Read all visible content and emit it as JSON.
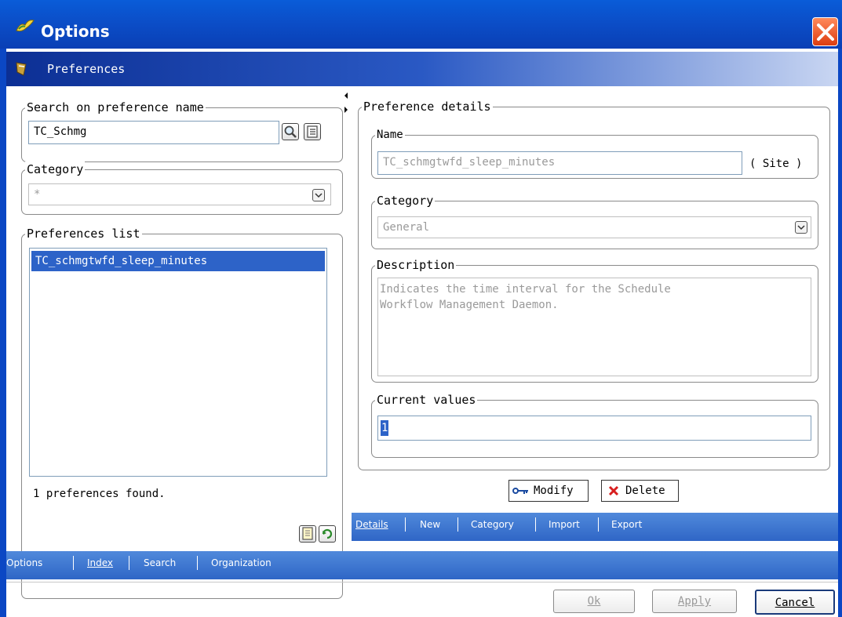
{
  "window": {
    "title": "Options",
    "icon": "options-app-icon",
    "close_icon": "close-icon"
  },
  "header": {
    "title": "Preferences",
    "icon": "preferences-icon"
  },
  "search": {
    "legend": "Search on preference name",
    "value": "TC_Schmg",
    "search_icon": "search-icon",
    "list_icon": "list-icon"
  },
  "category_filter": {
    "legend": "Category",
    "value": "*"
  },
  "pref_list": {
    "legend": "Preferences list",
    "items": [
      "TC_schmgtwfd_sleep_minutes"
    ],
    "status": "1 preferences found."
  },
  "details": {
    "legend": "Preference details",
    "name_legend": "Name",
    "name_value": "TC_schmgtwfd_sleep_minutes",
    "scope": "( Site )",
    "category_legend": "Category",
    "category_value": "General",
    "description_legend": "Description",
    "description_line1": "Indicates the time interval for the Schedule",
    "description_line2": "Workflow Management Daemon.",
    "current_legend": "Current values",
    "current_value": "1"
  },
  "actions": {
    "modify": "Modify",
    "delete": "Delete"
  },
  "right_tabs": [
    "Details",
    "New",
    "Category",
    "Import",
    "Export"
  ],
  "bottom_tabs": [
    "Options",
    "Index",
    "Search",
    "Organization"
  ],
  "footer": {
    "ok": "Ok",
    "apply": "Apply",
    "cancel": "Cancel"
  },
  "colors": {
    "titlebar": "#0b4ec8",
    "selection": "#2d63c8",
    "tabbar": "#3a72cf"
  }
}
